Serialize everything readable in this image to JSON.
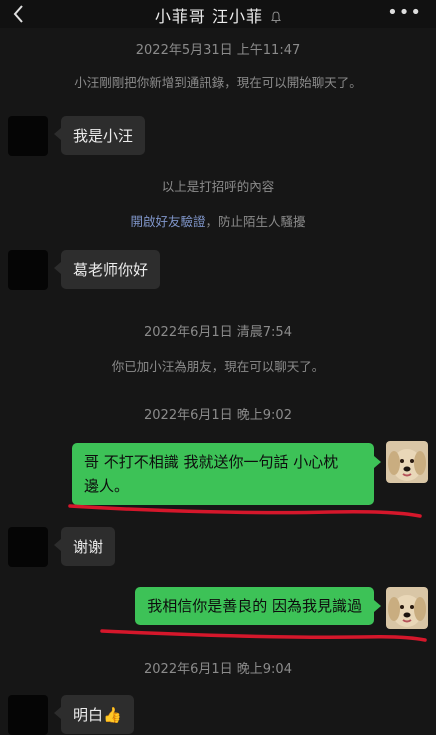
{
  "header": {
    "title": "小菲哥 汪小菲",
    "more_label": "•••",
    "back_icon": "chevron-left-icon",
    "mute_icon": "bell-mute-icon"
  },
  "messages": {
    "ts1": "2022年5月31日 上午11:47",
    "notice1": "小汪剛剛把你新增到通訊錄，現在可以開始聊天了。",
    "msg1": "我是小汪",
    "notice2": "以上是打招呼的內容",
    "verify_link": "開啟好友驗證",
    "verify_rest": "，防止陌生人騷擾",
    "msg2": "葛老师你好",
    "ts2": "2022年6月1日 清晨7:54",
    "notice3": "你已加小汪為朋友，現在可以聊天了。",
    "ts3": "2022年6月1日 晚上9:02",
    "msg3_line1": "哥 不打不相識 我就送你一句話 小心枕",
    "msg3_line2": "邊人。",
    "msg4": "谢谢",
    "msg5": "我相信你是善良的 因為我見識過",
    "ts4": "2022年6月1日 晚上9:04",
    "msg6": "明白👍"
  },
  "colors": {
    "background": "#161616",
    "sent_bubble": "#3dc257",
    "received_bubble": "#2d2d2d",
    "annotation_underline": "#d5172b",
    "link": "#7f95c9"
  }
}
